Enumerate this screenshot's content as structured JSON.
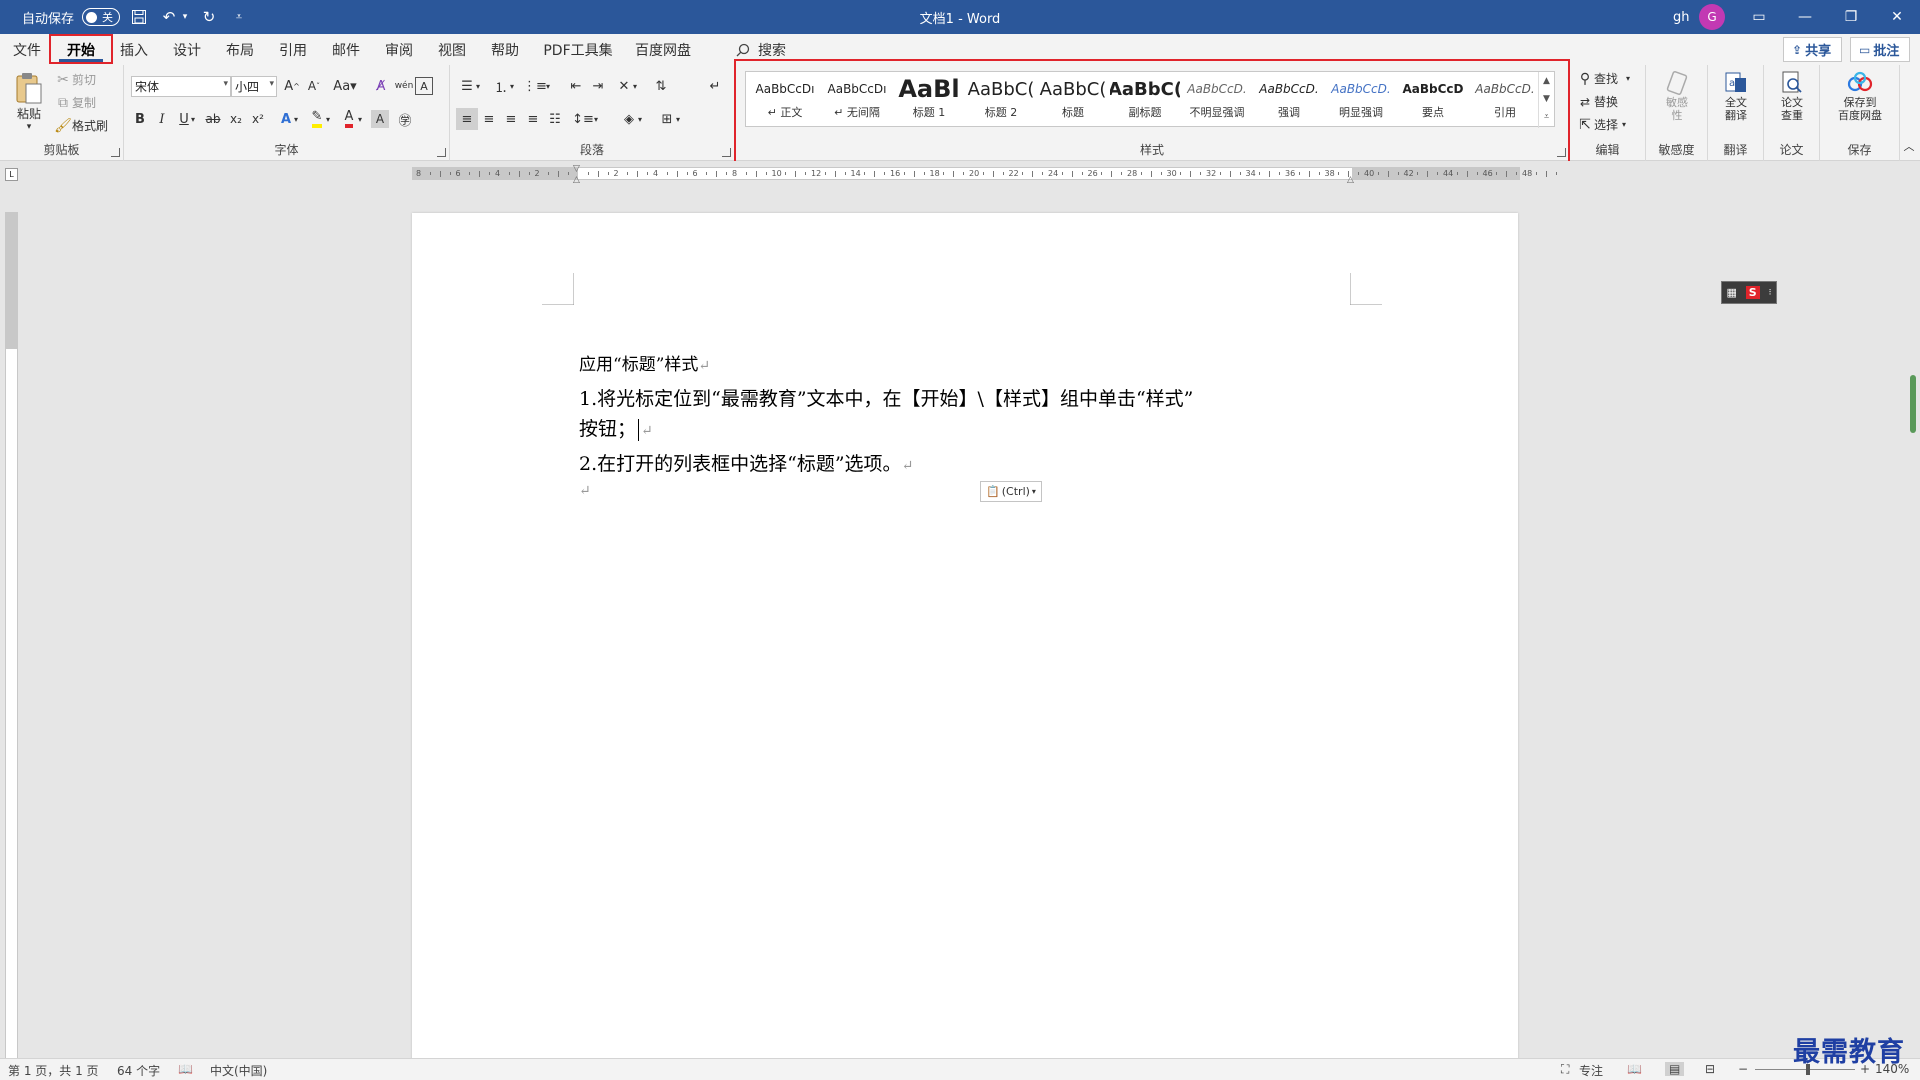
{
  "titlebar": {
    "autosave_label": "自动保存",
    "autosave_state": "关",
    "doc_title": "文档1  -  Word",
    "user": "gh",
    "avatar_letter": "G"
  },
  "tabs": [
    "文件",
    "开始",
    "插入",
    "设计",
    "布局",
    "引用",
    "邮件",
    "审阅",
    "视图",
    "帮助",
    "PDF工具集",
    "百度网盘"
  ],
  "active_tab": "开始",
  "search_label": "搜索",
  "share_label": "共享",
  "comment_label": "批注",
  "clipboard": {
    "paste": "粘贴",
    "cut": "剪切",
    "copy": "复制",
    "format_painter": "格式刷",
    "label": "剪贴板"
  },
  "font": {
    "name": "宋体",
    "size": "小四",
    "label": "字体"
  },
  "paragraph": {
    "label": "段落"
  },
  "styles": {
    "label": "样式",
    "items": [
      {
        "sample": "AaBbCcDı",
        "name": "↵ 正文"
      },
      {
        "sample": "AaBbCcDı",
        "name": "↵ 无间隔"
      },
      {
        "sample": "AaBl",
        "name": "标题 1"
      },
      {
        "sample": "AaBbC(",
        "name": "标题 2"
      },
      {
        "sample": "AaBbC(",
        "name": "标题"
      },
      {
        "sample": "AaBbC(",
        "name": "副标题"
      },
      {
        "sample": "AaBbCcD.",
        "name": "不明显强调"
      },
      {
        "sample": "AaBbCcD.",
        "name": "强调"
      },
      {
        "sample": "AaBbCcD.",
        "name": "明显强调"
      },
      {
        "sample": "AaBbCcD",
        "name": "要点"
      },
      {
        "sample": "AaBbCcD.",
        "name": "引用"
      }
    ]
  },
  "editing": {
    "find": "查找",
    "replace": "替换",
    "select": "选择",
    "label": "编辑"
  },
  "sensitivity": {
    "button": "敏感\n性",
    "label": "敏感度"
  },
  "translate": {
    "button": "全文\n翻译",
    "label": "翻译"
  },
  "paper": {
    "button": "论文\n查重",
    "label": "论文"
  },
  "save": {
    "button": "保存到\n百度网盘",
    "label": "保存"
  },
  "ruler": {
    "ticks": [
      "8",
      "6",
      "4",
      "2",
      "",
      "2",
      "4",
      "6",
      "8",
      "10",
      "12",
      "14",
      "16",
      "18",
      "20",
      "22",
      "24",
      "26",
      "28",
      "30",
      "32",
      "34",
      "36",
      "38",
      "40",
      "42",
      "44",
      "46",
      "48"
    ]
  },
  "document": {
    "line1": "应用“标题”样式",
    "line2a": "1.将光标定位到“最需教育”文本中，在【开始】\\【样式】组中单击“样式”",
    "line2b": "按钮；",
    "line3": "2.在打开的列表框中选择“标题”选项。",
    "paste_options": "(Ctrl)"
  },
  "statusbar": {
    "page": "第 1 页，共 1 页",
    "words": "64 个字",
    "language": "中文(中国)",
    "focus": "专注",
    "zoom": "140%"
  },
  "watermark": "最需教育",
  "colors": {
    "titlebar": "#2b579a",
    "highlight_box": "#e0242b",
    "avatar": "#c239b3"
  }
}
